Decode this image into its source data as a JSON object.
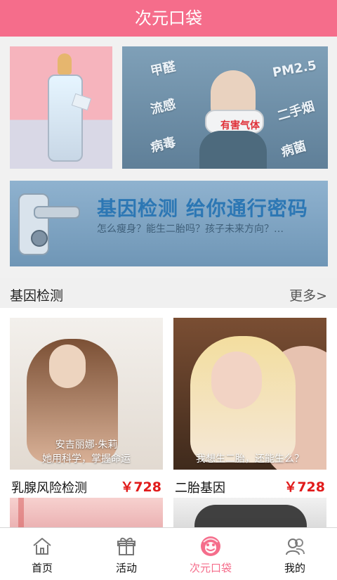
{
  "header": {
    "title": "次元口袋"
  },
  "banners": {
    "air_words": [
      "甲醛",
      "流感",
      "病毒",
      "PM2.5",
      "二手烟",
      "病菌"
    ],
    "air_mask_text": "有害气体",
    "gene_title": "基因检测  给你通行密码",
    "gene_subtitle": "怎么瘦身？能生二胎吗？孩子未来方向？…"
  },
  "section": {
    "title": "基因检测",
    "more": "更多>"
  },
  "products": [
    {
      "caption": "安吉丽娜·朱莉\n她用科学，掌握命运",
      "title": "乳腺风险检测",
      "price": "￥728"
    },
    {
      "caption": "我想生二胎，还能生么？",
      "title": "二胎基因",
      "price": "￥728"
    }
  ],
  "tabs": [
    {
      "label": "首页",
      "icon": "home-icon"
    },
    {
      "label": "活动",
      "icon": "gift-icon"
    },
    {
      "label": "次元口袋",
      "icon": "pocket-icon",
      "active": true
    },
    {
      "label": "我的",
      "icon": "users-icon"
    }
  ],
  "colors": {
    "brand": "#f56d8b",
    "price": "#e11b1b"
  }
}
